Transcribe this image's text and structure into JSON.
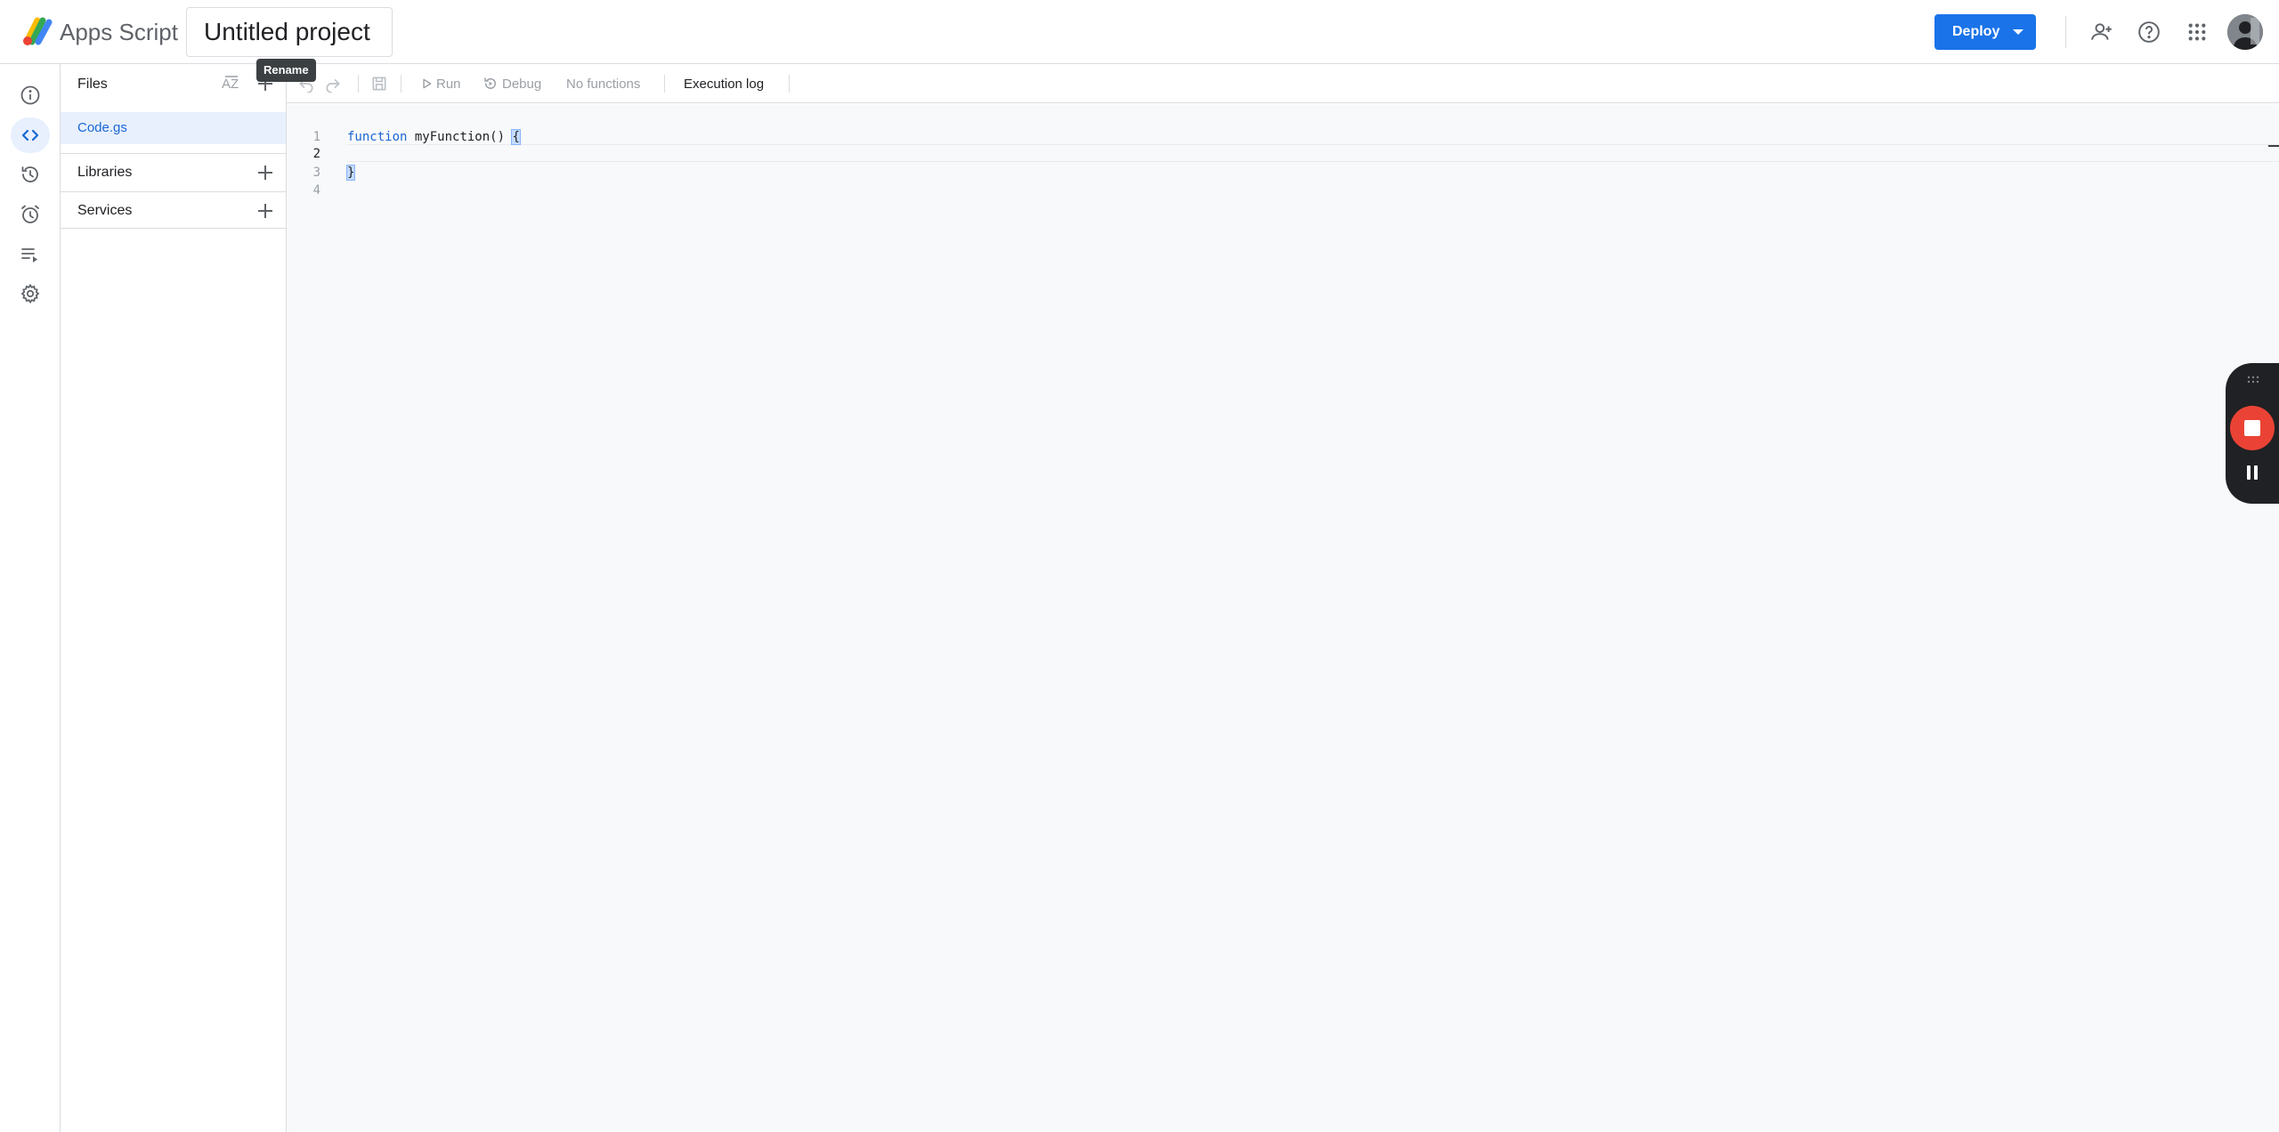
{
  "header": {
    "app_name": "Apps Script",
    "project_name": "Untitled project",
    "deploy_label": "Deploy"
  },
  "rail": {
    "items": [
      "info-icon",
      "code-icon",
      "history-icon",
      "trigger-clock-icon",
      "executions-icon",
      "settings-icon"
    ],
    "active": "code-icon"
  },
  "files_panel": {
    "title": "Files",
    "tooltip": "Rename",
    "files": [
      {
        "name": "Code.gs",
        "selected": true
      }
    ],
    "libraries_label": "Libraries",
    "services_label": "Services"
  },
  "toolbar": {
    "run_label": "Run",
    "debug_label": "Debug",
    "function_select": "No functions",
    "execution_log_label": "Execution log"
  },
  "editor": {
    "lines": [
      {
        "num": "1",
        "text": "function myFunction() {"
      },
      {
        "num": "2",
        "text": ""
      },
      {
        "num": "3",
        "text": "}"
      },
      {
        "num": "4",
        "text": ""
      }
    ],
    "keyword": "function",
    "function_name": "myFunction",
    "parens": "()",
    "open_brace": "{",
    "close_brace": "}"
  },
  "colors": {
    "accent": "#1a73e8",
    "selected_bg": "#e8f0fe",
    "record_red": "#ea4335"
  }
}
